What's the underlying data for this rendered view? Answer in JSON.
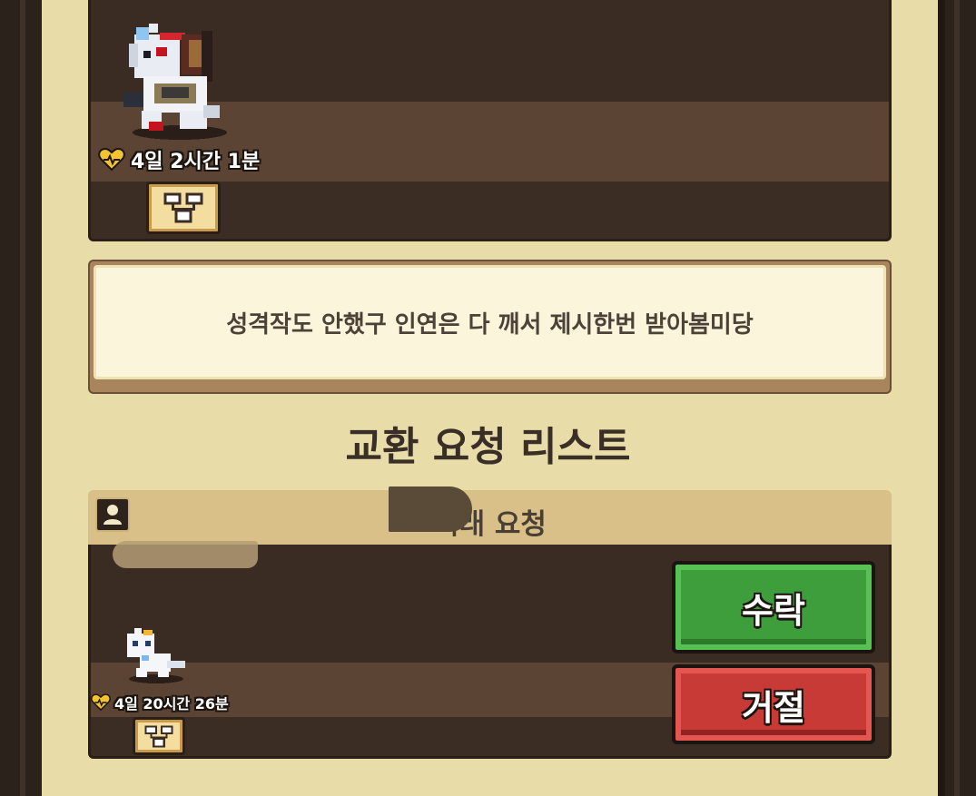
{
  "pet_card_top": {
    "timer_text": "4일 2시간 1분",
    "heart_icon": "heart-pulse-icon",
    "badge_icon": "family-tree-icon"
  },
  "message": {
    "text": "성격작도 안했구 인연은 다 깨서 제시한번 받아봄미당"
  },
  "section": {
    "title": "교환 요청 리스트"
  },
  "request": {
    "header_label": "거래 요청",
    "user_icon": "user-icon",
    "timer_text": "4일 20시간 26분",
    "heart_icon": "heart-pulse-icon",
    "badge_icon": "family-tree-icon",
    "accept_label": "수락",
    "reject_label": "거절"
  },
  "colors": {
    "paper": "#e8dca9",
    "card_dark": "#3a2c22",
    "accept": "#3f9e3c",
    "reject": "#c73a36"
  }
}
